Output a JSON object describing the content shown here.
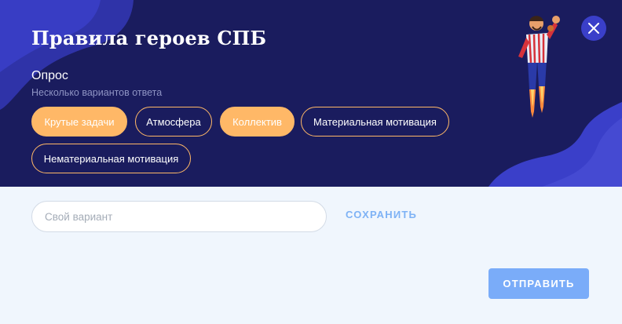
{
  "header": {
    "title": "Правила героев СПБ",
    "question_type": "Опрос",
    "question_hint": "Несколько вариантов ответа"
  },
  "options": [
    {
      "label": "Крутые задачи",
      "selected": true
    },
    {
      "label": "Атмосфера",
      "selected": false
    },
    {
      "label": "Коллектив",
      "selected": true
    },
    {
      "label": "Материальная мотивация",
      "selected": false
    },
    {
      "label": "Нематериальная мотивация",
      "selected": false
    }
  ],
  "custom": {
    "placeholder": "Свой вариант",
    "save_label": "СОХРАНИТЬ"
  },
  "footer": {
    "submit_label": "ОТПРАВИТЬ"
  },
  "icons": {
    "close": "close-icon",
    "mascot": "hero-mascot-illustration"
  },
  "colors": {
    "header_bg": "#1a1c5e",
    "accent_orange": "#ffb867",
    "accent_blue": "#7aacf9",
    "body_bg": "#f0f6fd",
    "wave": "#3a3fc9"
  }
}
